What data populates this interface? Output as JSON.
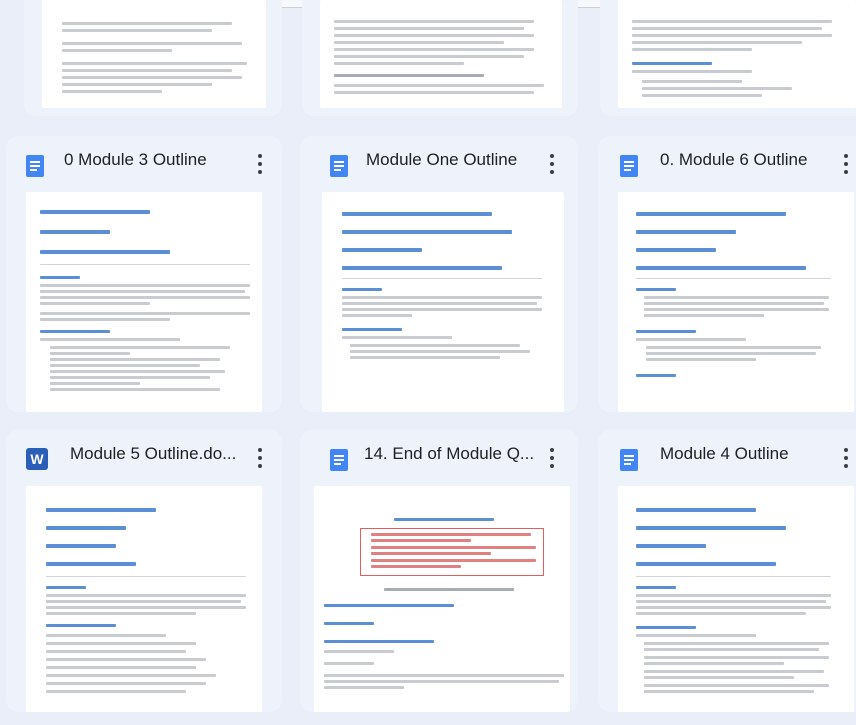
{
  "cards": [
    {
      "title": "0 Module 3 Outline",
      "icon": "docs-icon"
    },
    {
      "title": "Module One Outline",
      "icon": "docs-icon"
    },
    {
      "title": "0. Module 6 Outline",
      "icon": "docs-icon"
    },
    {
      "title": "Module 5 Outline.do...",
      "icon": "word-icon",
      "icon_letter": "W"
    },
    {
      "title": "14. End of Module Q...",
      "icon": "docs-icon"
    },
    {
      "title": "Module 4 Outline",
      "icon": "docs-icon"
    }
  ],
  "colors": {
    "background": "#e9eef8",
    "card": "#eef2fa",
    "docs_icon": "#4285f4",
    "word_icon": "#2b5eb7",
    "preview_heading": "#5a8fd6"
  }
}
